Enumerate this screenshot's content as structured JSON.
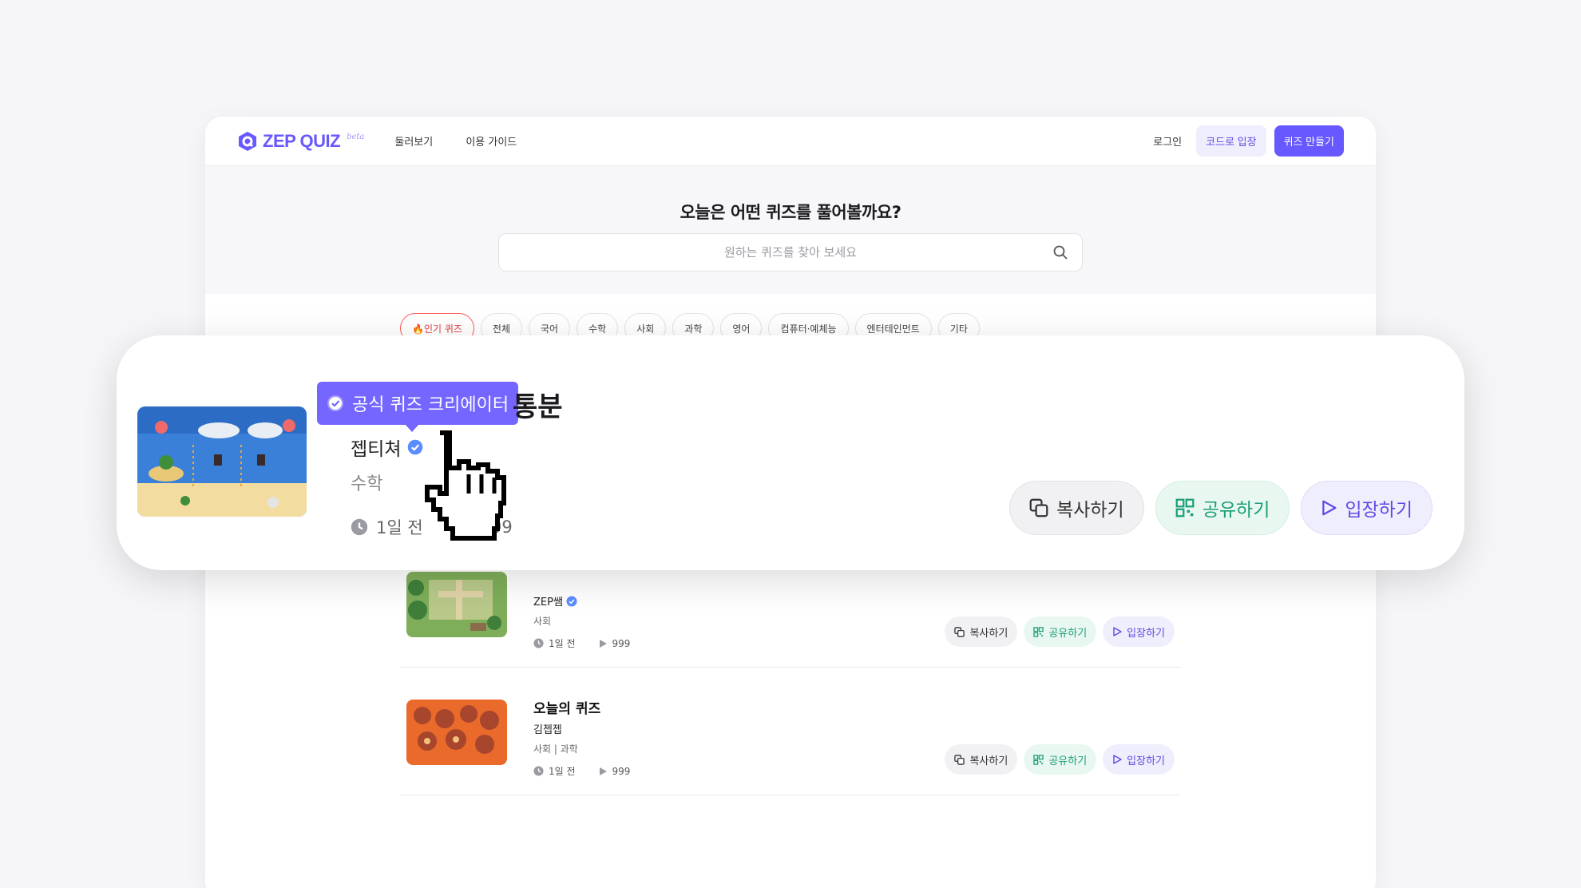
{
  "header": {
    "logo_text": "ZEP QUIZ",
    "logo_badge": "beta",
    "nav": [
      "둘러보기",
      "이용 가이드"
    ],
    "login_label": "로그인",
    "code_enter_label": "코드로 입장",
    "make_quiz_label": "퀴즈 만들기"
  },
  "hero": {
    "title": "오늘은 어떤 퀴즈를 풀어볼까요?",
    "search_placeholder": "원하는 퀴즈를 찾아 보세요"
  },
  "categories": [
    {
      "label": "🔥인기 퀴즈",
      "active": true
    },
    {
      "label": "전체"
    },
    {
      "label": "국어"
    },
    {
      "label": "수학"
    },
    {
      "label": "사회"
    },
    {
      "label": "과학"
    },
    {
      "label": "영어"
    },
    {
      "label": "컴퓨터·예체능"
    },
    {
      "label": "엔터테인먼트"
    },
    {
      "label": "기타"
    }
  ],
  "quizzes": [
    {
      "title": "",
      "author": "ZEP쌤",
      "category": "사회",
      "time": "1일 전",
      "plays": "999"
    },
    {
      "title": "오늘의 퀴즈",
      "author": "김젭젭",
      "category": "사회 | 과학",
      "time": "1일 전",
      "plays": "999"
    }
  ],
  "actions": {
    "copy": "복사하기",
    "share": "공유하기",
    "enter": "입장하기"
  },
  "zoom_card": {
    "title_tail": "통분",
    "author": "젭티쳐",
    "category": "수학",
    "time": "1일 전",
    "plays": "999",
    "tooltip": "공식 퀴즈 크리에이터"
  },
  "colors": {
    "brand": "#6758ff",
    "share_green": "#1b9e78",
    "verified_blue": "#5b8cff",
    "active_category_red": "#e03d3d"
  }
}
